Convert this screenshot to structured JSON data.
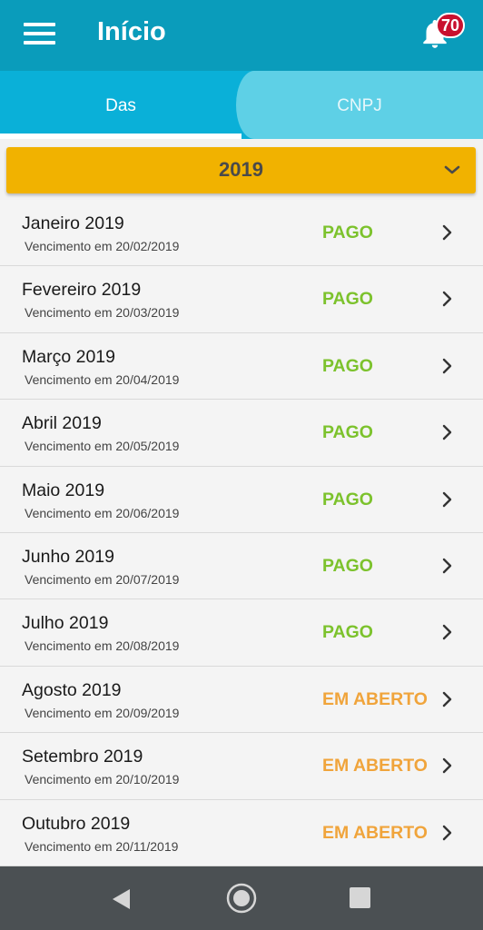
{
  "header": {
    "title": "Início",
    "menu_icon": "hamburger-menu-icon",
    "notification_icon": "bell-icon",
    "notification_count": "70",
    "bg_color": "#0a9cbb",
    "badge_color": "#c8102e"
  },
  "tabs": [
    {
      "label": "Das",
      "active": true
    },
    {
      "label": "CNPJ",
      "active": false
    }
  ],
  "year_selector": {
    "value": "2019",
    "icon": "chevron-down-icon",
    "color": "#f1b200"
  },
  "status_colors": {
    "paid": "#7cc22c",
    "open": "#f0a43b"
  },
  "items": [
    {
      "month": "Janeiro 2019",
      "due": "Vencimento em 20/02/2019",
      "status": "PAGO",
      "state": "paid"
    },
    {
      "month": "Fevereiro 2019",
      "due": "Vencimento em 20/03/2019",
      "status": "PAGO",
      "state": "paid"
    },
    {
      "month": "Março 2019",
      "due": "Vencimento em 20/04/2019",
      "status": "PAGO",
      "state": "paid"
    },
    {
      "month": "Abril 2019",
      "due": "Vencimento em 20/05/2019",
      "status": "PAGO",
      "state": "paid"
    },
    {
      "month": "Maio 2019",
      "due": "Vencimento em 20/06/2019",
      "status": "PAGO",
      "state": "paid"
    },
    {
      "month": "Junho 2019",
      "due": "Vencimento em 20/07/2019",
      "status": "PAGO",
      "state": "paid"
    },
    {
      "month": "Julho 2019",
      "due": "Vencimento em 20/08/2019",
      "status": "PAGO",
      "state": "paid"
    },
    {
      "month": "Agosto 2019",
      "due": "Vencimento em 20/09/2019",
      "status": "EM ABERTO",
      "state": "open"
    },
    {
      "month": "Setembro 2019",
      "due": "Vencimento em 20/10/2019",
      "status": "EM ABERTO",
      "state": "open"
    },
    {
      "month": "Outubro 2019",
      "due": "Vencimento em 20/11/2019",
      "status": "EM ABERTO",
      "state": "open"
    }
  ],
  "nav_bar": {
    "back_icon": "back-triangle-icon",
    "home_icon": "home-circle-icon",
    "recents_icon": "recents-square-icon"
  }
}
